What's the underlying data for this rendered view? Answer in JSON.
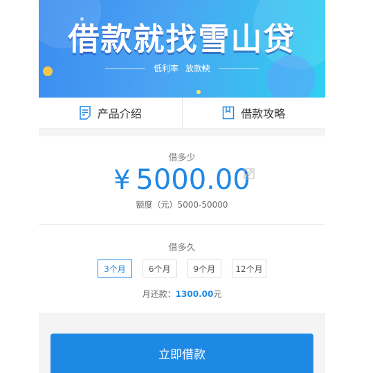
{
  "banner": {
    "headline": "借款就找雪山贷",
    "tag1": "低利率",
    "tag2": "放款快"
  },
  "tabs": [
    {
      "label": "产品介绍",
      "icon": "document-icon"
    },
    {
      "label": "借款攻略",
      "icon": "bookmark-icon"
    }
  ],
  "amount": {
    "label": "借多少",
    "currency": "¥",
    "value": "5000.00",
    "range": "额度（元）5000-50000"
  },
  "term": {
    "label": "借多久",
    "options": [
      "3个月",
      "6个月",
      "9个月",
      "12个月"
    ],
    "selected": "3个月"
  },
  "repayment": {
    "label": "月还款：",
    "value": "1300.00",
    "unit": "元"
  },
  "action": {
    "apply_label": "立即借款"
  },
  "colors": {
    "accent": "#1e88e5",
    "banner_start": "#3b8cf0",
    "banner_end": "#2fd0f0"
  }
}
